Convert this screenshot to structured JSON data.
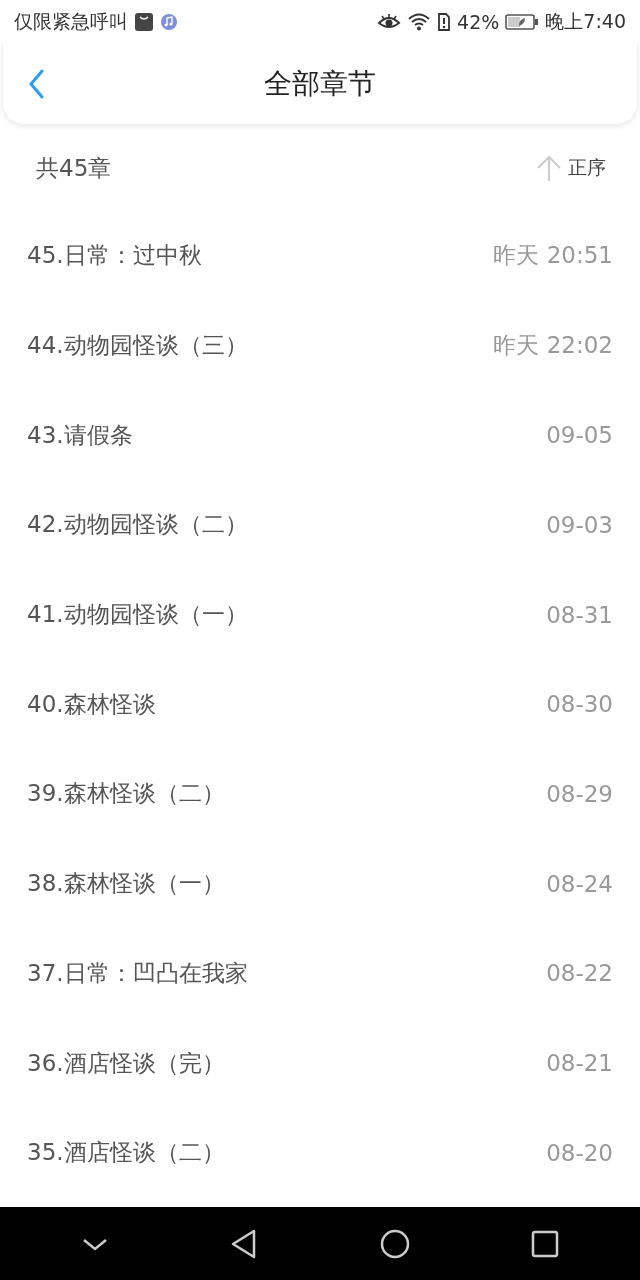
{
  "status_bar": {
    "carrier": "仅限紧急呼叫",
    "battery_percent": "42%",
    "time": "晚上7:40"
  },
  "header": {
    "title": "全部章节"
  },
  "summary": {
    "count": "共45章",
    "sort": "正序"
  },
  "chapters": [
    {
      "title": "45.日常：过中秋",
      "date": "昨天 20:51"
    },
    {
      "title": "44.动物园怪谈（三）",
      "date": "昨天 22:02"
    },
    {
      "title": "43.请假条",
      "date": "09-05"
    },
    {
      "title": "42.动物园怪谈（二）",
      "date": "09-03"
    },
    {
      "title": "41.动物园怪谈（一）",
      "date": "08-31"
    },
    {
      "title": "40.森林怪谈",
      "date": "08-30"
    },
    {
      "title": "39.森林怪谈（二）",
      "date": "08-29"
    },
    {
      "title": "38.森林怪谈（一）",
      "date": "08-24"
    },
    {
      "title": "37.日常：凹凸在我家",
      "date": "08-22"
    },
    {
      "title": "36.酒店怪谈（完）",
      "date": "08-21"
    },
    {
      "title": "35.酒店怪谈（二）",
      "date": "08-20"
    }
  ]
}
